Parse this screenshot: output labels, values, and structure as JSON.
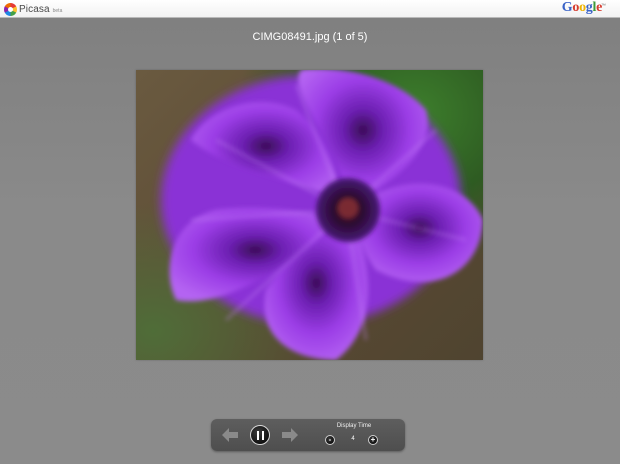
{
  "topbar": {
    "app_name": "Picasa",
    "beta_label": "beta",
    "brand_letters": [
      "G",
      "o",
      "o",
      "g",
      "l",
      "e"
    ],
    "brand_tm": "™"
  },
  "photo": {
    "title": "CIMG08491.jpg (1 of 5)"
  },
  "controls": {
    "display_time_label": "Display Time",
    "display_time_value": "4",
    "minus_label": "-",
    "plus_label": "+"
  },
  "icons": {
    "prev": "arrow-left-icon",
    "pause": "pause-icon",
    "next": "arrow-right-icon"
  }
}
